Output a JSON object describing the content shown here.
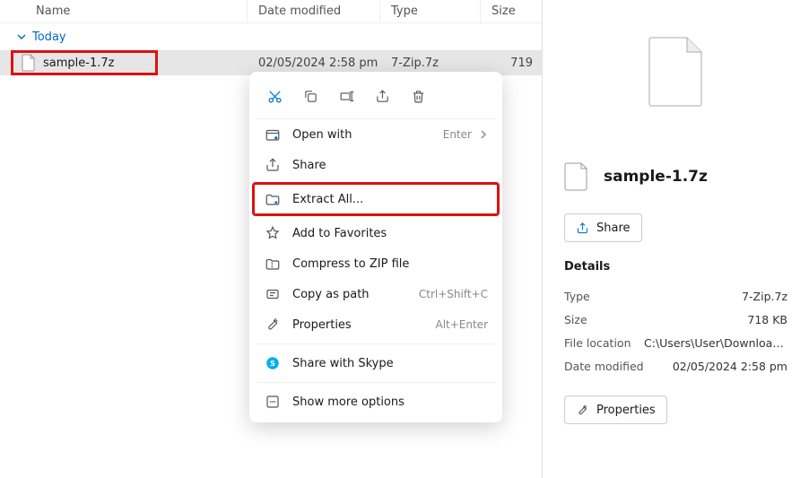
{
  "columns": {
    "name": "Name",
    "date": "Date modified",
    "type": "Type",
    "size": "Size"
  },
  "group": "Today",
  "file": {
    "name": "sample-1.7z",
    "date": "02/05/2024 2:58 pm",
    "type": "7-Zip.7z",
    "size_trunc": "719"
  },
  "ctx": {
    "open_with": "Open with",
    "open_with_hint": "Enter",
    "share": "Share",
    "extract_all": "Extract All...",
    "favorites": "Add to Favorites",
    "compress": "Compress to ZIP file",
    "copy_path": "Copy as path",
    "copy_path_hint": "Ctrl+Shift+C",
    "properties": "Properties",
    "properties_hint": "Alt+Enter",
    "skype": "Share with Skype",
    "more": "Show more options"
  },
  "details": {
    "filename": "sample-1.7z",
    "share_btn": "Share",
    "heading": "Details",
    "type_k": "Type",
    "type_v": "7-Zip.7z",
    "size_k": "Size",
    "size_v": "718 KB",
    "loc_k": "File location",
    "loc_v": "C:\\Users\\User\\Downloads\\sa...",
    "mod_k": "Date modified",
    "mod_v": "02/05/2024 2:58 pm",
    "properties_btn": "Properties"
  }
}
